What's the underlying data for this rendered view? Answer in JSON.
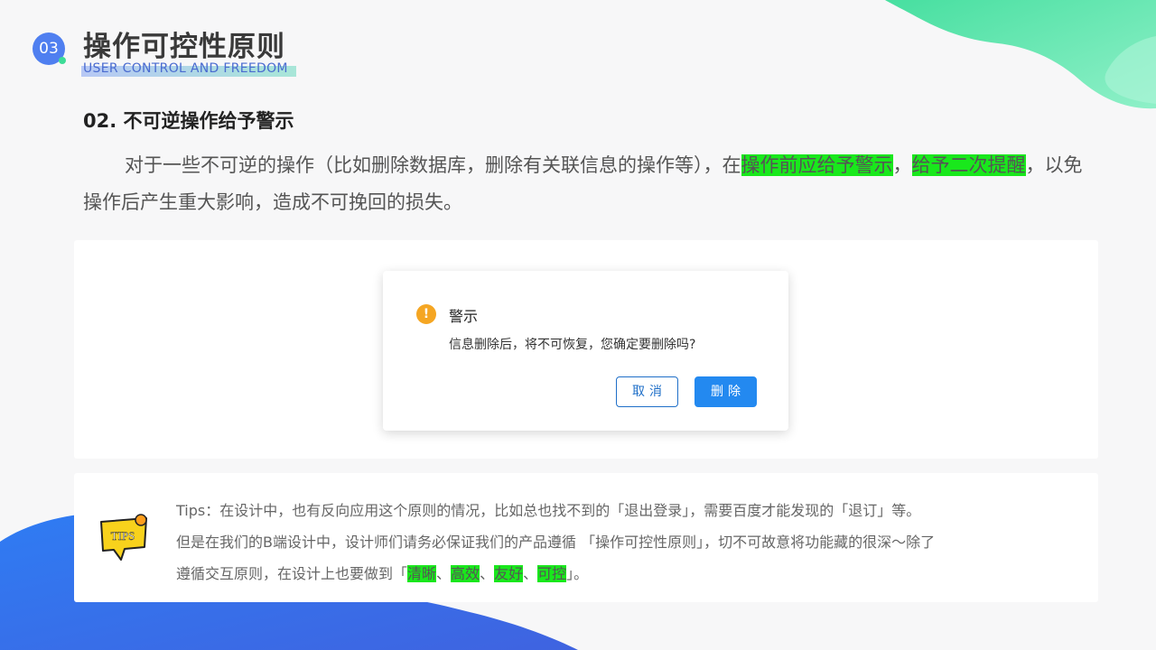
{
  "header": {
    "badge_number": "03",
    "title": "操作可控性原则",
    "subtitle": "USER CONTROL AND FREEDOM"
  },
  "section": {
    "heading": "02. 不可逆操作给予警示",
    "paragraph": {
      "part1": "对于一些不可逆的操作（比如删除数据库，删除有关联信息的操作等），在",
      "highlight1": "操作前应给予警示",
      "part2": "，",
      "highlight2": "给予二次提醒",
      "part3": "，以免操作后产生重大影响，造成不可挽回的损失。"
    }
  },
  "dialog": {
    "icon": "warning-icon",
    "icon_glyph": "!",
    "title": "警示",
    "message": "信息删除后，将不可恢复，您确定要删除吗?",
    "cancel_label": "取消",
    "delete_label": "删除"
  },
  "tips": {
    "icon": "tips-speech-bubble-icon",
    "icon_label": "TIPS",
    "line1": "Tips：在设计中，也有反向应用这个原则的情况，比如总也找不到的「退出登录」，需要百度才能发现的「退订」等。",
    "line2": "但是在我们的B端设计中，设计师们请务必保证我们的产品遵循 「操作可控性原则」，切不可故意将功能藏的很深～除了",
    "line3_prefix": "遵循交互原则，在设计上也要做到「",
    "keywords": [
      "清晰",
      "高效",
      "友好",
      "可控"
    ],
    "separator": "、",
    "line3_suffix": "」。"
  },
  "colors": {
    "highlight": "#19e81c",
    "badge": "#4f7ff0",
    "primary_button": "#2389f0",
    "warning": "#f5a623",
    "teal_blob": "#3ddc97",
    "blue_blob": "#2f7cf3"
  }
}
